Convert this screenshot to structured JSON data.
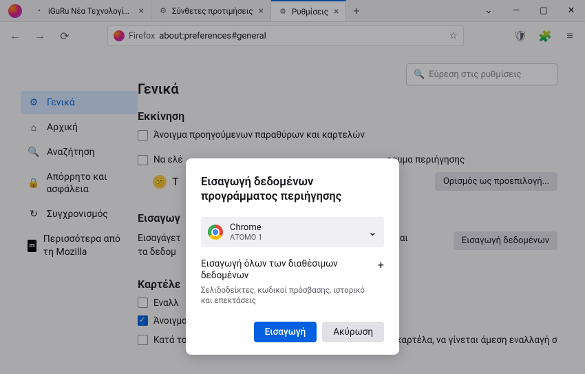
{
  "tabs": [
    {
      "label": "iGuRu Νέα Τεχνολογίας σε πρ",
      "icon": "•"
    },
    {
      "label": "Σύνθετες προτιμήσεις",
      "icon": "⚙"
    },
    {
      "label": "Ρυθμίσεις",
      "icon": "⚙"
    }
  ],
  "urlbar": {
    "brand": "Firefox",
    "url": "about:preferences#general"
  },
  "search": {
    "placeholder": "Εύρεση στις ρυθμίσεις"
  },
  "sidebar": {
    "items": [
      {
        "label": "Γενικά"
      },
      {
        "label": "Αρχική"
      },
      {
        "label": "Αναζήτηση"
      },
      {
        "label": "Απόρρητο και ασφάλεια"
      },
      {
        "label": "Συγχρονισμός"
      },
      {
        "label": "Περισσότερα από τη Mozilla"
      }
    ]
  },
  "content": {
    "pageTitle": "Γενικά",
    "startup": {
      "title": "Εκκίνηση",
      "openPrev": "Άνοιγμα προηγούμενων παραθύρων και καρτελών",
      "checkDefaultPrefix": "Να ελέ",
      "checkDefaultSuffix": "ραμμα περιήγησης",
      "notDefaultPrefix": "Τ",
      "setDefaultBtn": "Ορισμός ως προεπιλογή..."
    },
    "import": {
      "title": "Εισαγωγ",
      "descPrefix": "Εισαγάγετ",
      "descMid": "ρικό και",
      "descBottom": "τα δεδομ",
      "btn": "Εισαγωγή δεδομένων"
    },
    "tabsSection": {
      "title": "Καρτέλε",
      "ctrlTab": "Εναλλ",
      "linksInTabs": "Άνοιγμα συνδέσμων σε καρτέλες αντί για νέα παράθυρα",
      "bgTabPrefix": "Κατά το άνοιγμα συνδέσμου, εικόνας ή πολυμέσου σε νέα καρτέλα, να γίνεται άμεση εναλλαγή σ"
    }
  },
  "dialog": {
    "title": "Εισαγωγή δεδομένων προγράμματος περιήγησης",
    "browser": {
      "name": "Chrome",
      "profile": "ΑΤΟΜΟ 1"
    },
    "importAll": {
      "title": "Εισαγωγή όλων των διαθέσιμων δεδομένων",
      "sub": "Σελιδοδείκτες, κωδικοί πρόσβασης, ιστορικό και επεκτάσεις"
    },
    "primary": "Εισαγωγή",
    "secondary": "Ακύρωση"
  }
}
